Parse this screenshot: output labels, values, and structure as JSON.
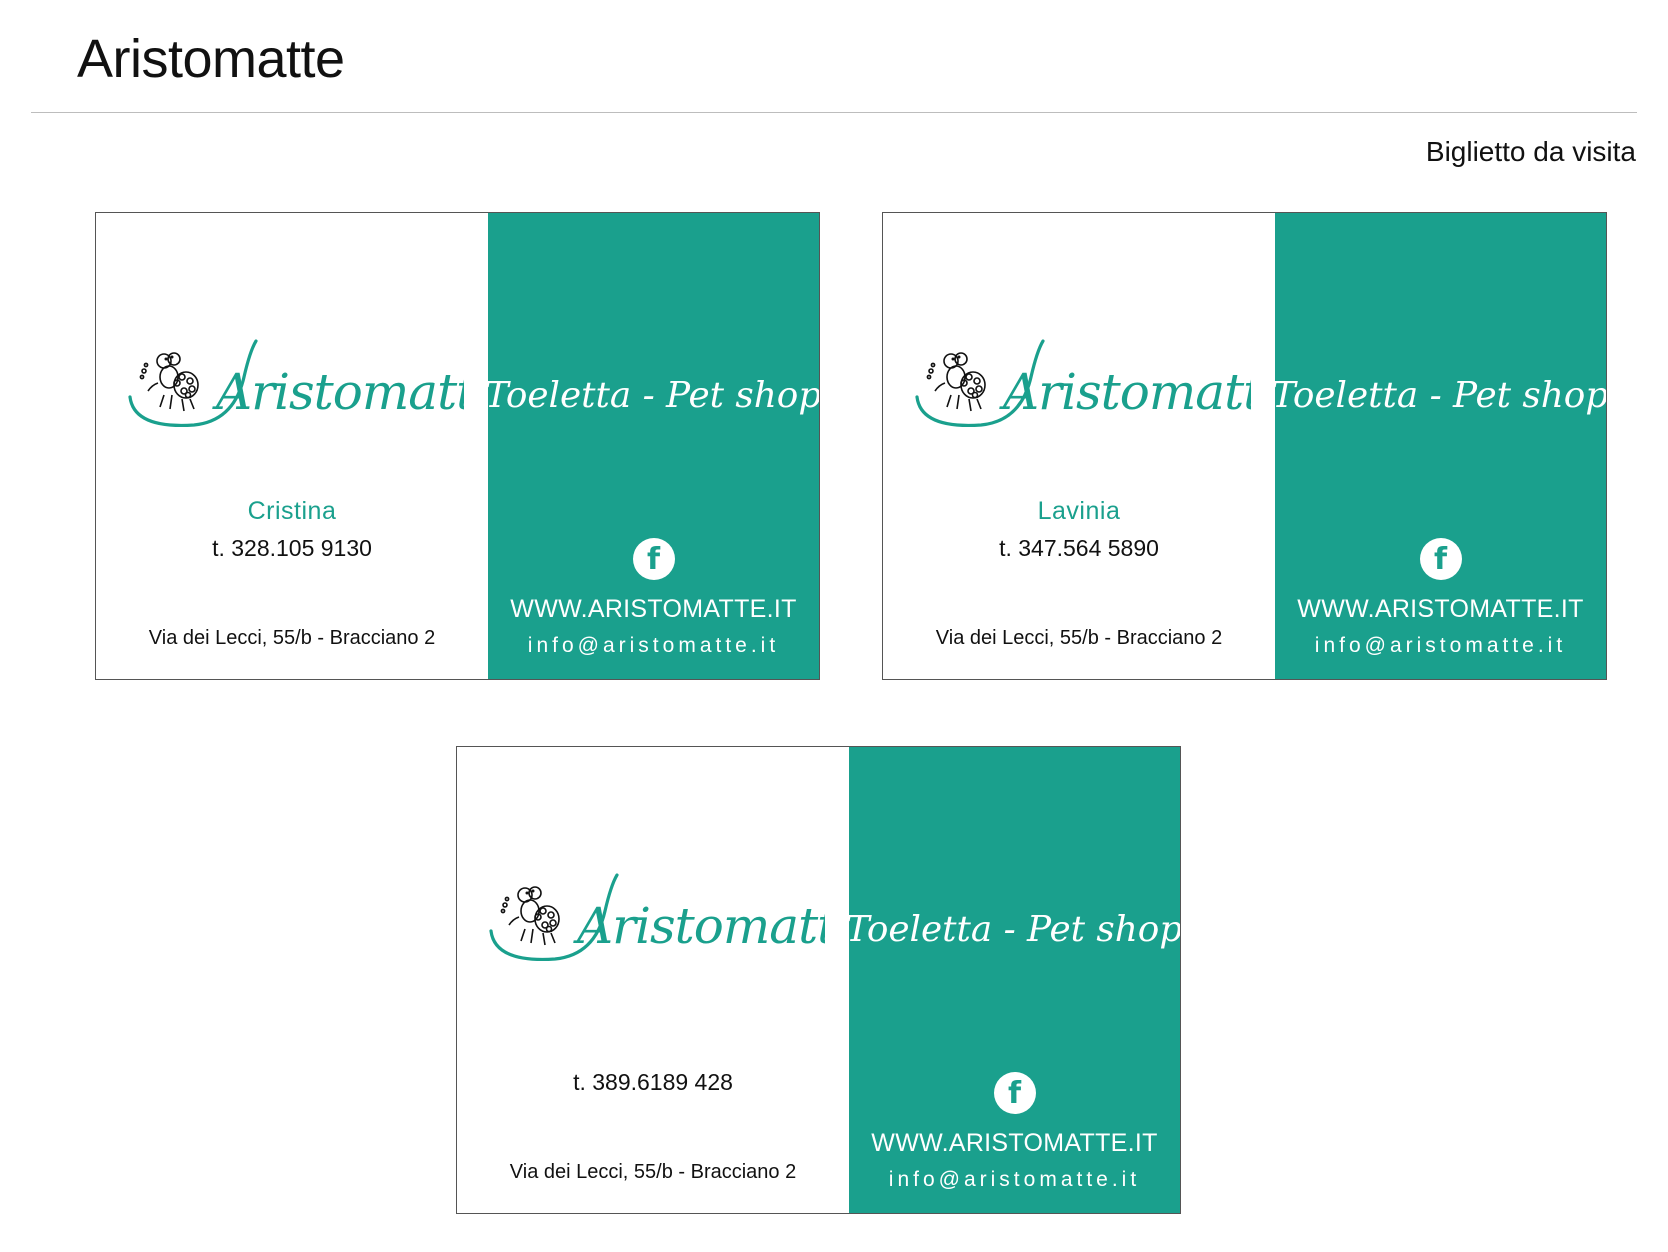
{
  "header": {
    "title": "Aristomatte",
    "subtitle": "Biglietto da visita"
  },
  "brand": {
    "logo_text": "Aristomatte",
    "tagline": "Toeletta - Pet shop",
    "accent_color": "#1aa08d",
    "icon": "facebook-icon",
    "facebook_glyph": "f"
  },
  "cards": [
    {
      "name": "Cristina",
      "phone": "t. 328.105 9130",
      "address": "Via dei Lecci, 55/b - Bracciano 2",
      "website": "WWW.ARISTOMATTE.IT",
      "email": "info@aristomatte.it"
    },
    {
      "name": "Lavinia",
      "phone": "t. 347.564 5890",
      "address": "Via dei Lecci, 55/b - Bracciano 2",
      "website": "WWW.ARISTOMATTE.IT",
      "email": "info@aristomatte.it"
    },
    {
      "name": "",
      "phone": "t. 389.6189 428",
      "address": "Via dei Lecci, 55/b - Bracciano 2",
      "website": "WWW.ARISTOMATTE.IT",
      "email": "info@aristomatte.it"
    }
  ]
}
